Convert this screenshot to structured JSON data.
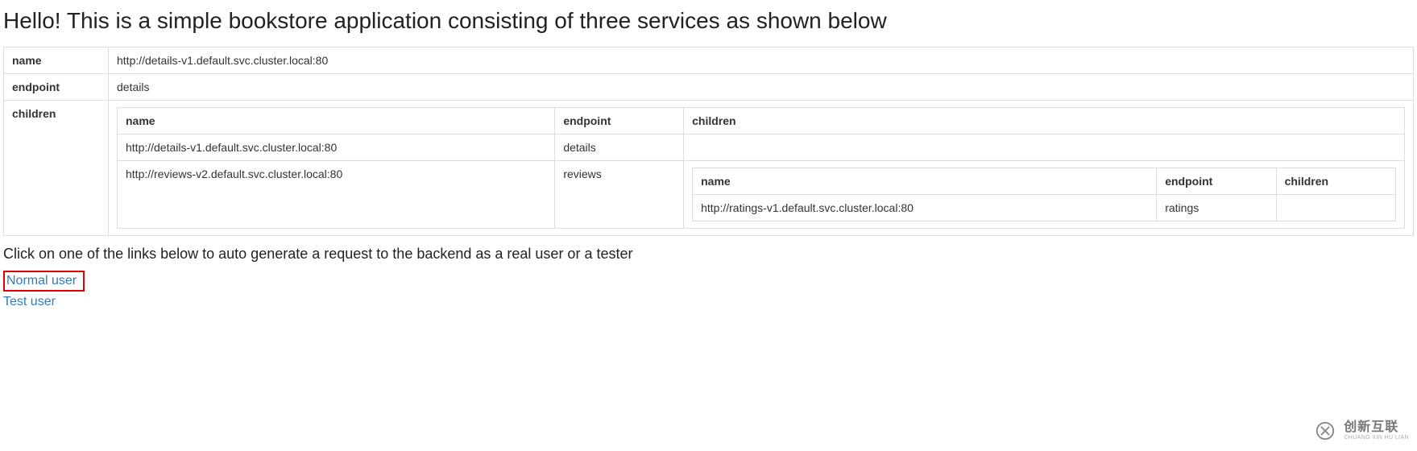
{
  "header": {
    "title": "Hello! This is a simple bookstore application consisting of three services as shown below"
  },
  "table": {
    "labels": {
      "name": "name",
      "endpoint": "endpoint",
      "children": "children"
    },
    "service": {
      "name": "http://details-v1.default.svc.cluster.local:80",
      "endpoint": "details",
      "children_headers": {
        "name": "name",
        "endpoint": "endpoint",
        "children": "children"
      },
      "children": [
        {
          "name": "http://details-v1.default.svc.cluster.local:80",
          "endpoint": "details",
          "children": null
        },
        {
          "name": "http://reviews-v2.default.svc.cluster.local:80",
          "endpoint": "reviews",
          "children": {
            "headers": {
              "name": "name",
              "endpoint": "endpoint",
              "children": "children"
            },
            "rows": [
              {
                "name": "http://ratings-v1.default.svc.cluster.local:80",
                "endpoint": "ratings",
                "children": ""
              }
            ]
          }
        }
      ]
    }
  },
  "subtext": "Click on one of the links below to auto generate a request to the backend as a real user or a tester",
  "links": {
    "normal_user": "Normal user",
    "test_user": "Test user"
  },
  "logo": {
    "cn": "创新互联",
    "en": "CHUANG XIN HU LIAN"
  }
}
